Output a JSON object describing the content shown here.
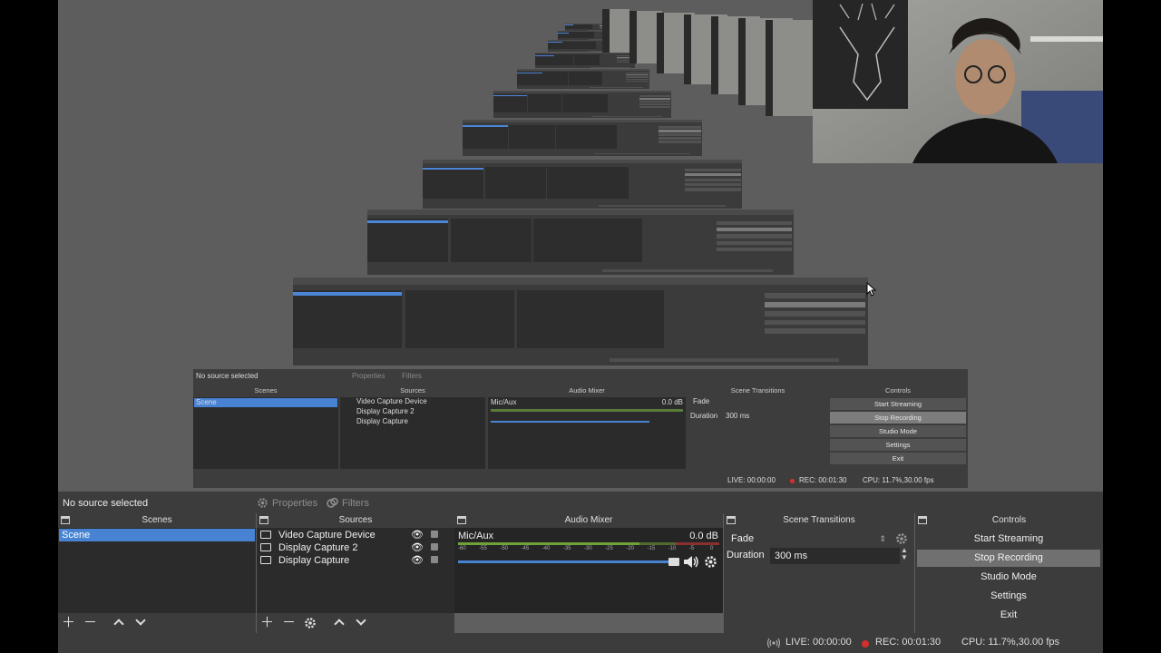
{
  "header": {
    "source_status": "No source selected",
    "properties_tab": "Properties",
    "filters_tab": "Filters"
  },
  "docks": {
    "scenes": "Scenes",
    "sources": "Sources",
    "audio_mixer": "Audio Mixer",
    "scene_transitions": "Scene Transitions",
    "controls": "Controls"
  },
  "scenes": {
    "items": [
      "Scene"
    ]
  },
  "sources": {
    "items": [
      "Video Capture Device",
      "Display Capture 2",
      "Display Capture"
    ]
  },
  "mixer": {
    "channel": "Mic/Aux",
    "level": "0.0 dB",
    "ticks": [
      "-60",
      "-55",
      "-50",
      "-45",
      "-40",
      "-35",
      "-30",
      "-25",
      "-20",
      "-15",
      "-10",
      "-5",
      "0"
    ]
  },
  "transitions": {
    "selected": "Fade",
    "duration_label": "Duration",
    "duration_value": "300 ms"
  },
  "controls": {
    "start_streaming": "Start Streaming",
    "stop_recording": "Stop Recording",
    "studio_mode": "Studio Mode",
    "settings": "Settings",
    "exit": "Exit"
  },
  "status": {
    "live": "LIVE: 00:00:00",
    "rec": "REC: 00:01:30",
    "cpu": "CPU: 11.7%,30.00 fps"
  },
  "colors": {
    "accent": "#4882d3",
    "rec_dot": "#d32f2f",
    "panel_bg": "#2b2b2b",
    "chrome_bg": "#3c3c3c"
  }
}
